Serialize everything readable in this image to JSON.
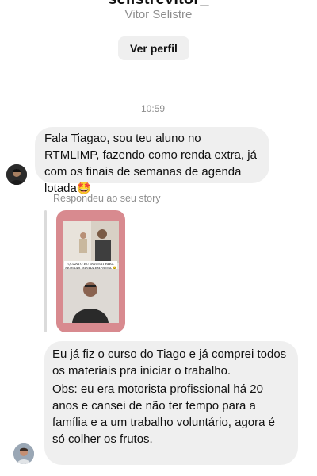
{
  "header": {
    "handle": "selistrevitor_",
    "name": "Vitor Selistre",
    "profile_button": "Ver perfil"
  },
  "thread": {
    "timestamp": "10:59",
    "message_1": "Fala Tiagao, sou teu aluno no RTMLIMP, fazendo como renda extra, já com os finais de semanas de agenda lotada🤩",
    "reply_label": "Respondeu ao seu story",
    "story_caption": "QUANTO EU INVESTI PARA MONTAR MINHA EMPRESA 😉",
    "message_2_p1": "Eu já fiz o curso do Tiago e já comprei todos os materiais pra iniciar o trabalho.",
    "message_2_p2": "Obs: eu era motorista profissional há 20 anos e cansei de não ter tempo para a família e a um trabalho voluntário, agora é só colher os frutos."
  },
  "icons": {
    "avatar_1": "user-avatar",
    "avatar_2": "user-avatar",
    "story": "story-thumbnail"
  },
  "colors": {
    "bubble": "#efefef",
    "muted_text": "#8e8e8e",
    "story_frame": "#d88a8f"
  }
}
